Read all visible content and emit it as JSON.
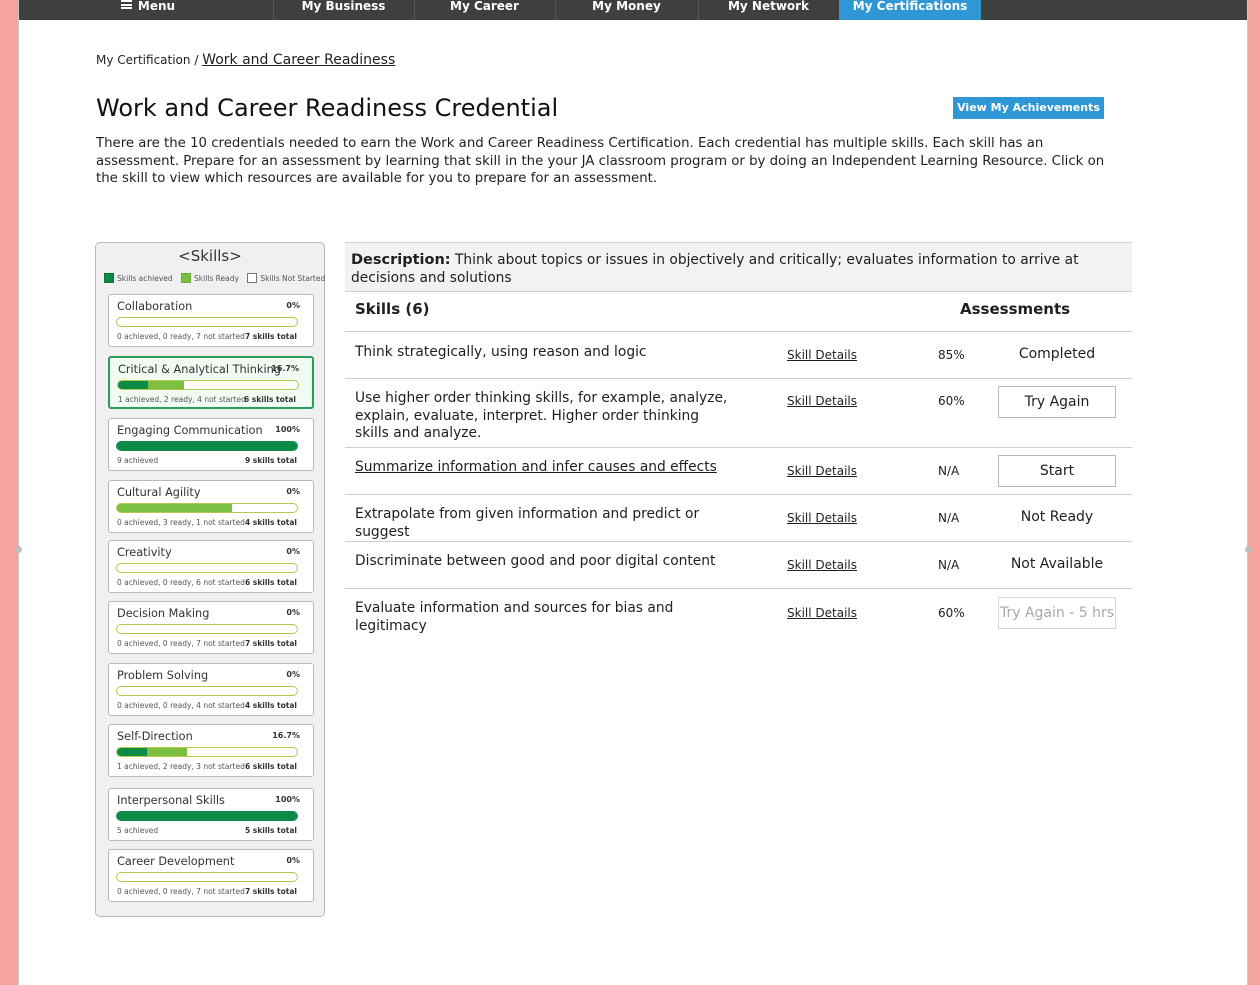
{
  "nav": {
    "menu_label": "Menu",
    "items": [
      "My Business",
      "My Career",
      "My Money",
      "My Network",
      "My Certifications"
    ],
    "active": "My Certifications",
    "active_color": "#2f97d6"
  },
  "breadcrumb": {
    "root": "My Certification /",
    "current": "Work and Career Readiness"
  },
  "page": {
    "title": "Work and Career Readiness Credential",
    "achievements_button": "View My Achievements",
    "intro": "There are the 10 credentials needed to earn the Work and Career Readiness Certification.  Each credential has multiple skills. Each skill has an assessment. Prepare for an assessment by learning that skill in the your JA classroom program or by doing an Independent Learning Resource.   Click on the skill to view which resources are available for you to prepare for an assessment."
  },
  "sidebar": {
    "title": "<Skills>",
    "legend": {
      "achieved": "Skills achieved",
      "ready": "Skills Ready",
      "not_started": "Skills Not Started"
    },
    "colors": {
      "achieved": "#0c8a48",
      "ready": "#7bc043"
    },
    "cards": [
      {
        "name": "Collaboration",
        "pct": "0%",
        "achieved_frac": 0,
        "ready_frac": 0,
        "status": "0 achieved, 0 ready, 7 not started",
        "total": "7 skills total",
        "selected": false
      },
      {
        "name": "Critical & Analytical Thinking",
        "pct": "16.7%",
        "achieved_frac": 0.167,
        "ready_frac": 0.2,
        "status": "1 achieved, 2 ready, 4 not started",
        "total": "6 skills total",
        "selected": true
      },
      {
        "name": "Engaging Communication",
        "pct": "100%",
        "achieved_frac": 1,
        "ready_frac": 0,
        "status": "9 achieved",
        "total": "9 skills total",
        "selected": false
      },
      {
        "name": "Cultural Agility",
        "pct": "0%",
        "achieved_frac": 0,
        "ready_frac": 0.64,
        "status": "0 achieved, 3 ready, 1 not started",
        "total": "4 skills total",
        "selected": false
      },
      {
        "name": "Creativity",
        "pct": "0%",
        "achieved_frac": 0,
        "ready_frac": 0,
        "status": "0 achieved, 0 ready, 6 not started",
        "total": "6 skills total",
        "selected": false
      },
      {
        "name": "Decision Making",
        "pct": "0%",
        "achieved_frac": 0,
        "ready_frac": 0,
        "status": "0 achieved, 0 ready, 7 not started",
        "total": "7 skills total",
        "selected": false
      },
      {
        "name": "Problem Solving",
        "pct": "0%",
        "achieved_frac": 0,
        "ready_frac": 0,
        "status": "0 achieved, 0 ready, 4 not started",
        "total": "4 skills total",
        "selected": false
      },
      {
        "name": "Self-Direction",
        "pct": "16.7%",
        "achieved_frac": 0.167,
        "ready_frac": 0.22,
        "status": "1 achieved, 2 ready, 3 not started",
        "total": "6 skills total",
        "selected": false
      },
      {
        "name": "Interpersonal Skills",
        "pct": "100%",
        "achieved_frac": 1,
        "ready_frac": 0,
        "status": "5 achieved",
        "total": "5 skills total",
        "selected": false
      },
      {
        "name": "Career Development",
        "pct": "0%",
        "achieved_frac": 0,
        "ready_frac": 0,
        "status": "0 achieved, 0 ready, 7 not started",
        "total": "7 skills total",
        "selected": false
      }
    ]
  },
  "detail": {
    "description_label": "Description:",
    "description_text": "Think about topics or issues in objectively and critically; evaluates information to arrive at decisions and solutions",
    "skills_header": "Skills (6)",
    "assessments_header": "Assessments",
    "details_label": "Skill Details",
    "rows": [
      {
        "skill": "Think strategically, using reason and logic",
        "link": false,
        "score": "85%",
        "action": "Completed",
        "kind": "text"
      },
      {
        "skill": "Use higher order thinking skills, for example, analyze, explain, evaluate, interpret. Higher order thinking skills and analyze.",
        "link": false,
        "score": "60%",
        "action": "Try Again",
        "kind": "button"
      },
      {
        "skill": "Summarize information and infer causes and effects",
        "link": true,
        "score": "N/A",
        "action": "Start",
        "kind": "button"
      },
      {
        "skill": "Extrapolate from given information and predict or suggest",
        "link": false,
        "score": "N/A",
        "action": "Not Ready",
        "kind": "text"
      },
      {
        "skill": "Discriminate between good and poor digital content",
        "link": false,
        "score": "N/A",
        "action": "Not Available",
        "kind": "text"
      },
      {
        "skill": "Evaluate information and sources for bias and legitimacy",
        "link": false,
        "score": "60%",
        "action": "Try Again - 5 hrs",
        "kind": "disabled"
      }
    ]
  }
}
